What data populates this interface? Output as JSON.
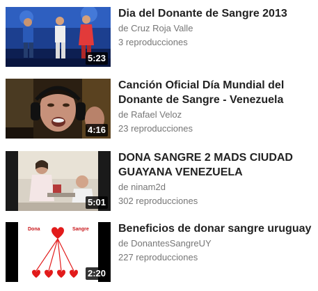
{
  "videos": [
    {
      "title": "Dia del Donante de Sangre 2013",
      "channel": "de Cruz Roja Valle",
      "views": "3 reproducciones",
      "duration": "5:23",
      "thumbnail": "tv-studio-interview-thumbnail"
    },
    {
      "title": "Canción Oficial Día Mundial del Donante de Sangre - Venezuela",
      "channel": "de Rafael Veloz",
      "views": "23 reproducciones",
      "duration": "4:16",
      "thumbnail": "singer-with-headphones-thumbnail"
    },
    {
      "title": "DONA SANGRE 2 MADS CIUDAD GUAYANA VENEZUELA",
      "channel": "de ninam2d",
      "views": "302 reproducciones",
      "duration": "5:01",
      "thumbnail": "blood-donation-room-thumbnail"
    },
    {
      "title": "Beneficios de donar sangre uruguay",
      "channel": "de DonantesSangreUY",
      "views": "227 reproducciones",
      "duration": "2:20",
      "thumbnail": "dona-sangre-hearts-thumbnail",
      "thumbnail_text": [
        "Dona",
        "Sangre"
      ]
    }
  ]
}
